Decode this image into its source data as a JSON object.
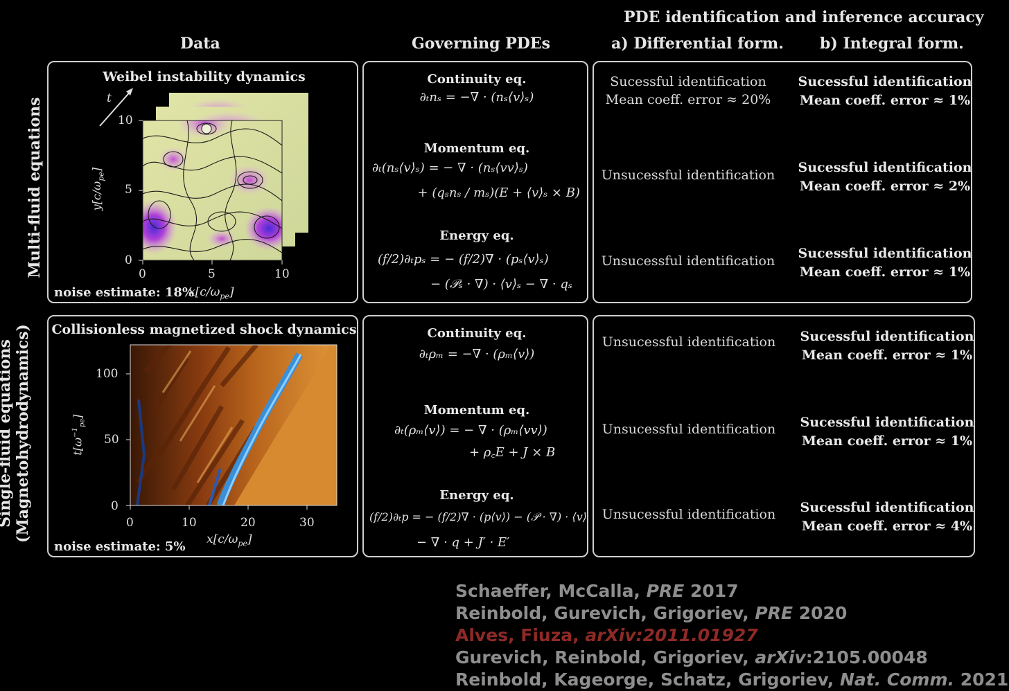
{
  "headers": {
    "top": "PDE identification and inference accuracy",
    "data": "Data",
    "governing": "Governing PDEs",
    "differential": "a) Differential form.",
    "integral": "b) Integral form."
  },
  "rows": [
    {
      "label": "Multi-fluid equations",
      "panel_title": "Weibel instability dynamics",
      "noise": "noise estimate: 18%",
      "axis": {
        "x": "x[c/ω",
        "x_sub": "pe",
        "x_end": "]",
        "y": "y[c/ω",
        "y_sub": "pe",
        "y_end": "]",
        "t": "t",
        "xticks": [
          "0",
          "5",
          "10"
        ],
        "yticks": [
          "0",
          "5",
          "10"
        ]
      },
      "equations": [
        {
          "title": "Continuity eq.",
          "lines": [
            "∂ₜnₛ = −∇ · (nₛ⟨v⟩ₛ)"
          ]
        },
        {
          "title": "Momentum eq.",
          "lines": [
            "∂ₜ(nₛ⟨v⟩ₛ) = − ∇ · (nₛ⟨vv⟩ₛ)",
            "+ (qₛnₛ / mₛ)(E + ⟨v⟩ₛ × B)"
          ]
        },
        {
          "title": "Energy eq.",
          "lines": [
            "(f/2)∂ₜpₛ = − (f/2)∇ · (pₛ⟨v⟩ₛ)",
            "− (𝒫ₛ · ∇) · ⟨v⟩ₛ − ∇ · qₛ"
          ]
        }
      ],
      "differential": [
        [
          "Sucessful identification",
          "Mean coeff. error ≈ 20%"
        ],
        [
          "Unsucessful identification"
        ],
        [
          "Unsucessful identification"
        ]
      ],
      "integral": [
        [
          "Sucessful identification",
          "Mean coeff. error ≈ 1%"
        ],
        [
          "Sucessful identification",
          "Mean coeff. error ≈ 2%"
        ],
        [
          "Sucessful identification",
          "Mean coeff. error ≈ 1%"
        ]
      ]
    },
    {
      "label_line1": "Single-fluid equations",
      "label_line2": "(Magnetohydrodynamics)",
      "panel_title": "Collisionless magnetized shock dynamics",
      "noise": "noise estimate: 5%",
      "axis": {
        "x": "x[c/ω",
        "x_sub": "pe",
        "x_end": "]",
        "y": "t[ω",
        "y_sup": "−1",
        "y_sub": "pe",
        "y_end": "]",
        "xticks": [
          "0",
          "10",
          "20",
          "30"
        ],
        "yticks": [
          "0",
          "50",
          "100"
        ]
      },
      "equations": [
        {
          "title": "Continuity eq.",
          "lines": [
            "∂ₜρₘ = −∇ · (ρₘ⟨v⟩)"
          ]
        },
        {
          "title": "Momentum eq.",
          "lines": [
            "∂ₜ(ρₘ⟨v⟩) = − ∇ · (ρₘ⟨vv⟩)",
            "+ ρ꜀E + J × B"
          ]
        },
        {
          "title": "Energy eq.",
          "lines": [
            "(f/2)∂ₜp = − (f/2)∇ · (p⟨v⟩) − (𝒫 · ∇) · ⟨v⟩",
            "− ∇ · q + J′ · E′"
          ]
        }
      ],
      "differential": [
        [
          "Unsucessful identification"
        ],
        [
          "Unsucessful identification"
        ],
        [
          "Unsucessful identification"
        ]
      ],
      "integral": [
        [
          "Sucessful identification",
          "Mean coeff. error ≈ 1%"
        ],
        [
          "Sucessful identification",
          "Mean coeff. error ≈ 1%"
        ],
        [
          "Sucessful identification",
          "Mean coeff. error ≈ 4%"
        ]
      ]
    }
  ],
  "references": [
    {
      "authors": "Schaeffer, McCalla, ",
      "journal": "PRE",
      "year": " 2017",
      "highlight": false
    },
    {
      "authors": "Reinbold, Gurevich, Grigoriev, ",
      "journal": "PRE",
      "year": " 2020",
      "highlight": false
    },
    {
      "authors": "Alves, Fiuza, ",
      "journal": "arXiv:2011.01927",
      "year": "",
      "highlight": true
    },
    {
      "authors": "Gurevich, Reinbold, Grigoriev, ",
      "journal": "arXiv",
      "year": ":2105.00048",
      "highlight": false
    },
    {
      "authors": "Reinbold, Kageorge, Schatz, Grigoriev, ",
      "journal": "Nat. Comm.",
      "year": " 2021",
      "highlight": false
    }
  ],
  "colors": {
    "border": "#cfcfcf",
    "highlight_ref": "#8e2a26",
    "ref_text": "#8e8e8e",
    "background": "#000000"
  }
}
